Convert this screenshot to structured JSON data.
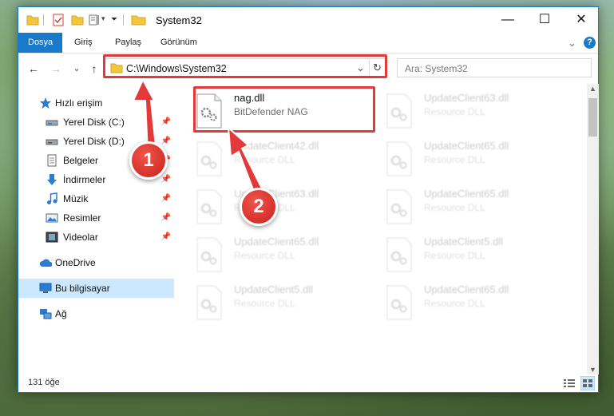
{
  "window": {
    "title": "System32",
    "minimize_glyph": "—",
    "maximize_glyph": "☐",
    "close_glyph": "✕",
    "help_glyph": "?",
    "collapse_glyph": "⌄",
    "accent": "#1979ca"
  },
  "ribbon": {
    "tabs": [
      {
        "label": "Dosya",
        "active": true
      },
      {
        "label": "Giriş",
        "active": false
      },
      {
        "label": "Paylaş",
        "active": false
      },
      {
        "label": "Görünüm",
        "active": false
      }
    ]
  },
  "navigation": {
    "back_glyph": "←",
    "forward_glyph": "→",
    "recent_glyph": "⌄",
    "up_glyph": "↑",
    "address_path": "C:\\Windows\\System32",
    "address_dropdown_glyph": "⌄",
    "refresh_glyph": "↻",
    "search_placeholder": "Ara: System32"
  },
  "sidebar": {
    "quick_access": "Hızlı erişim",
    "items": [
      {
        "label": "Yerel Disk (C:)",
        "icon": "drive-icon",
        "pinned": true
      },
      {
        "label": "Yerel Disk (D:)",
        "icon": "drive-icon",
        "pinned": true
      },
      {
        "label": "Belgeler",
        "icon": "documents-icon",
        "pinned": true
      },
      {
        "label": "İndirmeler",
        "icon": "downloads-icon",
        "pinned": true
      },
      {
        "label": "Müzik",
        "icon": "music-icon",
        "pinned": true
      },
      {
        "label": "Resimler",
        "icon": "pictures-icon",
        "pinned": true
      },
      {
        "label": "Videolar",
        "icon": "videos-icon",
        "pinned": true
      }
    ],
    "onedrive": "OneDrive",
    "this_pc": "Bu bilgisayar",
    "network": "Ağ",
    "pin_glyph": "📌"
  },
  "files": [
    {
      "name": "nag.dll",
      "desc": "BitDefender NAG",
      "highlight": true
    },
    {
      "name": "UpdateClient63.dll",
      "desc": "Resource DLL"
    },
    {
      "name": "UpdateClient42.dll",
      "desc": "Resource DLL"
    },
    {
      "name": "UpdateClient65.dll",
      "desc": "Resource DLL"
    },
    {
      "name": "UpdateClient63.dll",
      "desc": "Resource DLL"
    },
    {
      "name": "UpdateClient65.dll",
      "desc": "Resource DLL"
    },
    {
      "name": "UpdateClient65.dll",
      "desc": "Resource DLL"
    },
    {
      "name": "UpdateClient5.dll",
      "desc": "Resource DLL"
    },
    {
      "name": "UpdateClient5.dll",
      "desc": "Resource DLL"
    },
    {
      "name": "UpdateClient65.dll",
      "desc": "Resource DLL"
    }
  ],
  "status": {
    "item_count": "131 öğe"
  },
  "annotations": {
    "step1": "1",
    "step2": "2",
    "color": "#e23a3a"
  }
}
